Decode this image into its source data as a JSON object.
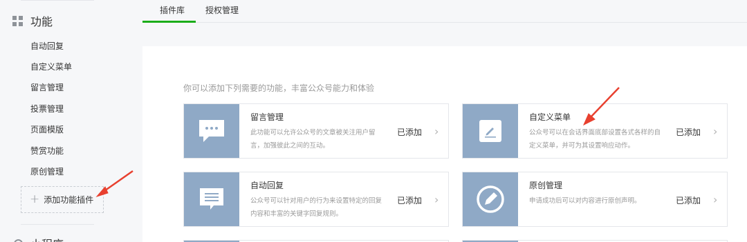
{
  "sidebar": {
    "section_title": "功能",
    "items": [
      "自动回复",
      "自定义菜单",
      "留言管理",
      "投票管理",
      "页面模版",
      "赞赏功能",
      "原创管理"
    ],
    "add_label": "添加功能插件",
    "next_section": "小程序"
  },
  "tabs": [
    "插件库",
    "授权管理"
  ],
  "main": {
    "intro": "你可以添加下列需要的功能，丰富公众号能力和体验",
    "cards": [
      {
        "title": "留言管理",
        "desc": "此功能可以允许公众号的文章被关注用户留言，加强彼此之间的互动。",
        "status": "已添加",
        "icon": "comment-bubble-icon"
      },
      {
        "title": "自定义菜单",
        "desc": "公众号可以在会话界面底部设置各式各样的自定义菜单，并可为其设置响应动作。",
        "status": "已添加",
        "icon": "pencil-edit-icon"
      },
      {
        "title": "自动回复",
        "desc": "公众号可以针对用户的行为来设置特定的回复内容和丰富的关键字回复规则。",
        "status": "已添加",
        "icon": "message-lines-icon"
      },
      {
        "title": "原创管理",
        "desc": "申请成功后可以对内容进行原创声明。",
        "status": "已添加",
        "icon": "original-pen-circle-icon"
      }
    ]
  },
  "colors": {
    "accent": "#1aad19",
    "thumb": "#8fa9c6",
    "annotation_arrow": "#e8402f"
  }
}
